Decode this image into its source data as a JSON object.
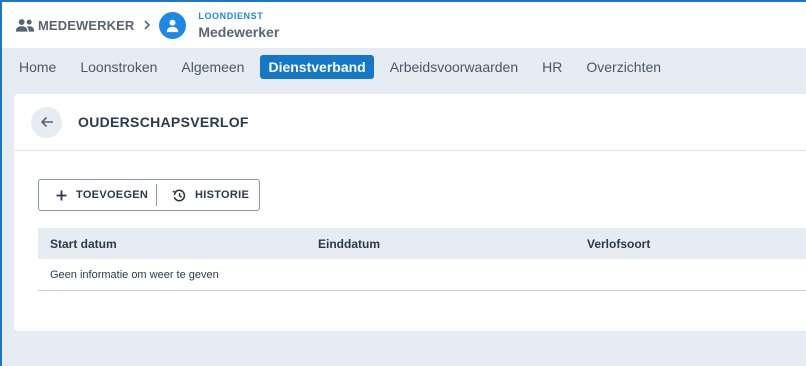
{
  "header": {
    "breadcrumb_label": "MEDEWERKER",
    "breadcrumb_icon": "people-icon",
    "employee_category": "LOONDIENST",
    "employee_name": "Medewerker"
  },
  "tabs": [
    {
      "label": "Home",
      "active": false
    },
    {
      "label": "Loonstroken",
      "active": false
    },
    {
      "label": "Algemeen",
      "active": false
    },
    {
      "label": "Dienstverband",
      "active": true
    },
    {
      "label": "Arbeidsvoorwaarden",
      "active": false
    },
    {
      "label": "HR",
      "active": false
    },
    {
      "label": "Overzichten",
      "active": false
    }
  ],
  "page": {
    "title": "OUDERSCHAPSVERLOF"
  },
  "actions": {
    "add_label": "TOEVOEGEN",
    "history_label": "HISTORIE"
  },
  "table": {
    "columns": [
      "Start datum",
      "Einddatum",
      "Verlofsoort"
    ],
    "empty_message": "Geen informatie om weer te geven"
  },
  "colors": {
    "accent": "#1477c7",
    "avatar": "#1e88e5",
    "background": "#e7ecf2"
  }
}
